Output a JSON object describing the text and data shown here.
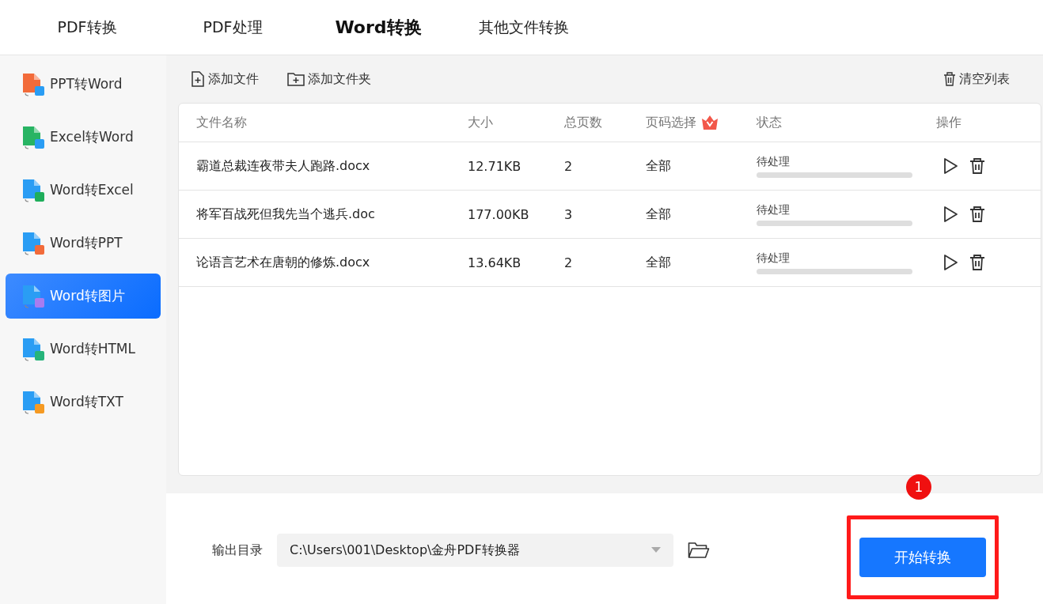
{
  "tabs": [
    {
      "label": "PDF转换",
      "selected": false
    },
    {
      "label": "PDF处理",
      "selected": false
    },
    {
      "label": "Word转换",
      "selected": true
    },
    {
      "label": "其他文件转换",
      "selected": false
    }
  ],
  "sidebar": {
    "items": [
      {
        "label": "PPT转Word",
        "selected": false,
        "color": "#f26b3a",
        "badge": {
          "color": "#2a9df4"
        }
      },
      {
        "label": "Excel转Word",
        "selected": false,
        "color": "#28b463",
        "badge": {
          "color": "#2a9df4"
        }
      },
      {
        "label": "Word转Excel",
        "selected": false,
        "color": "#2a9df4",
        "badge": {
          "color": "#1fae5b"
        }
      },
      {
        "label": "Word转PPT",
        "selected": false,
        "color": "#2a9df4",
        "badge": {
          "color": "#f26b3a"
        }
      },
      {
        "label": "Word转图片",
        "selected": true,
        "color": "#2a9df4",
        "badge": {
          "color": "#a77cf0"
        }
      },
      {
        "label": "Word转HTML",
        "selected": false,
        "color": "#2a9df4",
        "badge": {
          "color": "#26b47a"
        }
      },
      {
        "label": "Word转TXT",
        "selected": false,
        "color": "#2a9df4",
        "badge": {
          "color": "#f59a23"
        }
      }
    ]
  },
  "toolbar": {
    "add_file": "添加文件",
    "add_folder": "添加文件夹",
    "clear_list": "清空列表"
  },
  "table": {
    "columns": [
      "文件名称",
      "大小",
      "总页数",
      "页码选择",
      "状态",
      "操作"
    ],
    "rows": [
      {
        "name": "霸道总裁连夜带夫人跑路.docx",
        "size": "12.71KB",
        "pages": "2",
        "range": "全部",
        "status": "待处理",
        "level": 0
      },
      {
        "name": "将军百战死但我先当个逃兵.doc",
        "size": "177.00KB",
        "pages": "3",
        "range": "全部",
        "status": "待处理",
        "level": 0
      },
      {
        "name": "论语言艺术在唐朝的修炼.docx",
        "size": "13.64KB",
        "pages": "2",
        "range": "全部",
        "status": "待处理",
        "level": 0
      }
    ]
  },
  "output": {
    "label": "输出目录",
    "path": "C:\\Users\\001\\Desktop\\金舟PDF转换器"
  },
  "start_button": "开始转换",
  "annotation": {
    "number": "1"
  }
}
